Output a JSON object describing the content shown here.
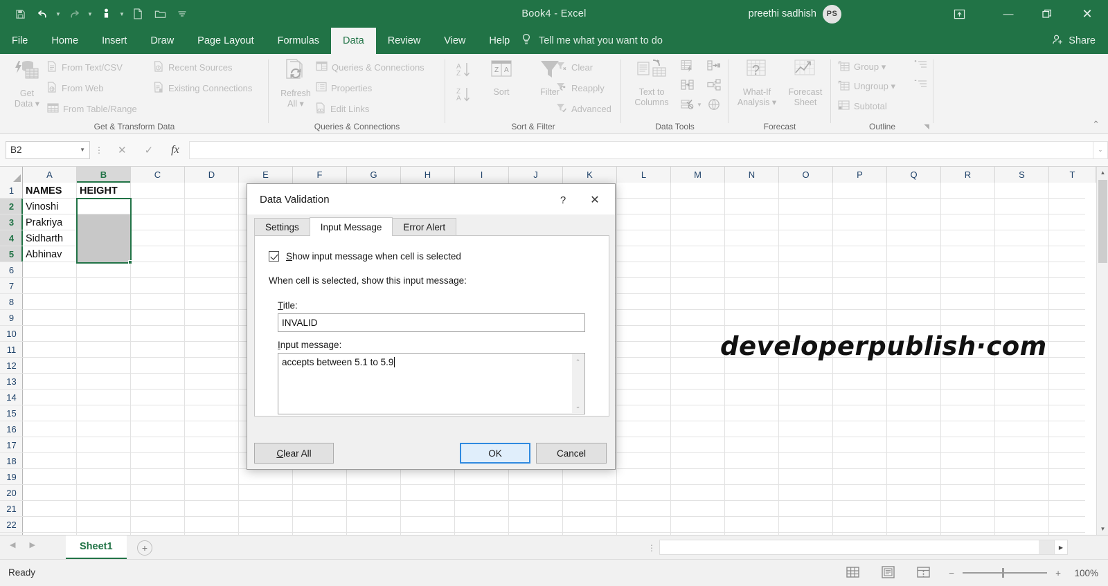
{
  "titlebar": {
    "document_title": "Book4  -  Excel",
    "account_name": "preethi sadhish",
    "avatar_initials": "PS",
    "quick_access": [
      {
        "name": "save-icon",
        "glyph": "💾"
      },
      {
        "name": "undo-icon",
        "glyph": "↶"
      },
      {
        "name": "redo-icon",
        "glyph": "↷"
      },
      {
        "name": "touch-mode-icon",
        "glyph": "✋"
      },
      {
        "name": "new-file-icon",
        "glyph": "🗋"
      },
      {
        "name": "open-folder-icon",
        "glyph": "📁"
      },
      {
        "name": "customize-qat-icon",
        "glyph": "≡"
      }
    ],
    "window_buttons": {
      "minimize": "—",
      "restore": "❐",
      "close": "✕"
    },
    "ribbon_display_options": "❐"
  },
  "ribbon": {
    "tabs": [
      {
        "label": "File",
        "active": false
      },
      {
        "label": "Home",
        "active": false
      },
      {
        "label": "Insert",
        "active": false
      },
      {
        "label": "Draw",
        "active": false
      },
      {
        "label": "Page Layout",
        "active": false
      },
      {
        "label": "Formulas",
        "active": false
      },
      {
        "label": "Data",
        "active": true
      },
      {
        "label": "Review",
        "active": false
      },
      {
        "label": "View",
        "active": false
      },
      {
        "label": "Help",
        "active": false
      }
    ],
    "tell_me": "Tell me what you want to do",
    "share_label": "Share",
    "groups": [
      {
        "name": "Get & Transform Data",
        "label": "Get & Transform Data",
        "big": [
          {
            "line1": "Get",
            "line2": "Data ▾"
          }
        ],
        "items": [
          "From Text/CSV",
          "From Web",
          "From Table/Range",
          "Recent Sources",
          "Existing Connections"
        ]
      },
      {
        "name": "Queries & Connections",
        "label": "Queries & Connections",
        "big": [
          {
            "line1": "Refresh",
            "line2": "All ▾"
          }
        ],
        "items": [
          "Queries & Connections",
          "Properties",
          "Edit Links"
        ]
      },
      {
        "name": "Sort & Filter",
        "label": "Sort & Filter",
        "big": [
          {
            "line1": "Sort",
            "line2": ""
          },
          {
            "line1": "Filter",
            "line2": ""
          }
        ],
        "items": [
          "Clear",
          "Reapply",
          "Advanced"
        ]
      },
      {
        "name": "Data Tools",
        "label": "Data Tools",
        "big": [
          {
            "line1": "Text to",
            "line2": "Columns"
          }
        ],
        "items": []
      },
      {
        "name": "Forecast",
        "label": "Forecast",
        "big": [
          {
            "line1": "What-If",
            "line2": "Analysis ▾"
          },
          {
            "line1": "Forecast",
            "line2": "Sheet"
          }
        ],
        "items": []
      },
      {
        "name": "Outline",
        "label": "Outline",
        "big": [],
        "items": [
          "Group  ▾",
          "Ungroup  ▾",
          "Subtotal"
        ]
      }
    ],
    "collapse_icon": "⌃"
  },
  "formula_bar": {
    "name_box_value": "B2",
    "cancel_icon": "✕",
    "enter_icon": "✓",
    "function_icon": "fx",
    "formula_value": "",
    "expand_icon": "⌄"
  },
  "grid": {
    "columns": [
      "A",
      "B",
      "C",
      "D",
      "E",
      "F",
      "G",
      "H",
      "I",
      "J",
      "K",
      "L",
      "M",
      "N",
      "O",
      "P",
      "Q",
      "R",
      "S",
      "T"
    ],
    "selected_columns": [
      "B"
    ],
    "rows": [
      1,
      2,
      3,
      4,
      5,
      6,
      7,
      8,
      9,
      10,
      11,
      12,
      13,
      14,
      15,
      16,
      17,
      18,
      19,
      20,
      21,
      22
    ],
    "selected_rows": [
      2,
      3,
      4,
      5
    ],
    "cells": [
      {
        "col": 0,
        "row": 0,
        "value": "NAMES",
        "bold": true
      },
      {
        "col": 1,
        "row": 0,
        "value": "HEIGHT",
        "bold": true
      },
      {
        "col": 0,
        "row": 1,
        "value": "Vinoshi",
        "bold": false
      },
      {
        "col": 0,
        "row": 2,
        "value": "Prakriya",
        "bold": false
      },
      {
        "col": 0,
        "row": 3,
        "value": "Sidharth",
        "bold": false
      },
      {
        "col": 0,
        "row": 4,
        "value": "Abhinav",
        "bold": false
      }
    ],
    "active_cell": "B2",
    "selection_range": "B2:B5",
    "watermark": "developerpublish·com"
  },
  "dialog": {
    "title": "Data Validation",
    "help_icon": "?",
    "close_icon": "✕",
    "tabs": [
      {
        "label": "Settings",
        "active": false
      },
      {
        "label": "Input Message",
        "active": true
      },
      {
        "label": "Error Alert",
        "active": false
      }
    ],
    "checkbox_label_pre": "S",
    "checkbox_label_rest": "how input message when cell is selected",
    "checkbox_checked": true,
    "instruction": "When cell is selected, show this input message:",
    "title_field_label_pre": "T",
    "title_field_label_rest": "itle:",
    "title_field_value": "INVALID",
    "message_field_label_pre": "I",
    "message_field_label_rest": "nput message:",
    "message_field_value": "accepts between 5.1 to 5.9",
    "buttons": {
      "clear_all_pre": "C",
      "clear_all_rest": "lear All",
      "ok": "OK",
      "cancel": "Cancel"
    },
    "scroll_up_icon": "⌃",
    "scroll_down_icon": "⌄"
  },
  "sheetbar": {
    "prev_icon": "◀",
    "next_icon": "▶",
    "tabs": [
      {
        "label": "Sheet1",
        "active": true
      }
    ],
    "add_sheet_icon": "+",
    "scroll_right_icon": "▶"
  },
  "statusbar": {
    "status": "Ready",
    "views": [
      {
        "name": "normal-view-icon",
        "glyph": "☷"
      },
      {
        "name": "page-layout-view-icon",
        "glyph": "▤"
      },
      {
        "name": "page-break-preview-icon",
        "glyph": "▥"
      }
    ],
    "zoom_out_icon": "−",
    "zoom_in_icon": "+",
    "zoom_value": "100%"
  },
  "colors": {
    "excel_green": "#217346",
    "selection_gray": "#c8c8c8",
    "primary_button_border": "#2f8ae0",
    "primary_button_fill": "#e0eefb"
  }
}
